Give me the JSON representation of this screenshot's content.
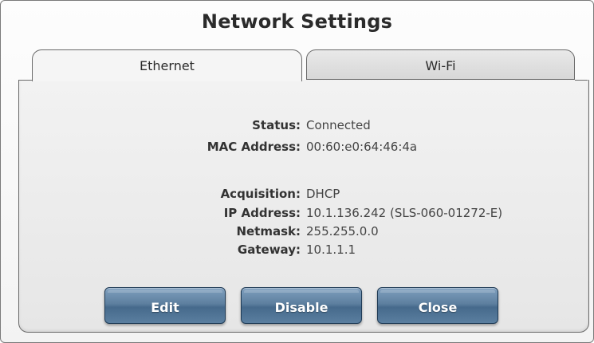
{
  "window": {
    "title": "Network Settings"
  },
  "tabs": [
    {
      "label": "Ethernet",
      "active": true
    },
    {
      "label": "Wi-Fi",
      "active": false
    }
  ],
  "details": {
    "status": {
      "label": "Status:",
      "value": "Connected"
    },
    "mac": {
      "label": "MAC Address:",
      "value": "00:60:e0:64:46:4a"
    },
    "acquisition": {
      "label": "Acquisition:",
      "value": "DHCP"
    },
    "ip": {
      "label": "IP Address:",
      "value": "10.1.136.242 (SLS-060-01272-E)"
    },
    "netmask": {
      "label": "Netmask:",
      "value": "255.255.0.0"
    },
    "gateway": {
      "label": "Gateway:",
      "value": "10.1.1.1"
    }
  },
  "buttons": {
    "edit": "Edit",
    "disable": "Disable",
    "close": "Close"
  },
  "colors": {
    "button_blue": "#5d7f9f",
    "panel_bg": "#ececec"
  }
}
